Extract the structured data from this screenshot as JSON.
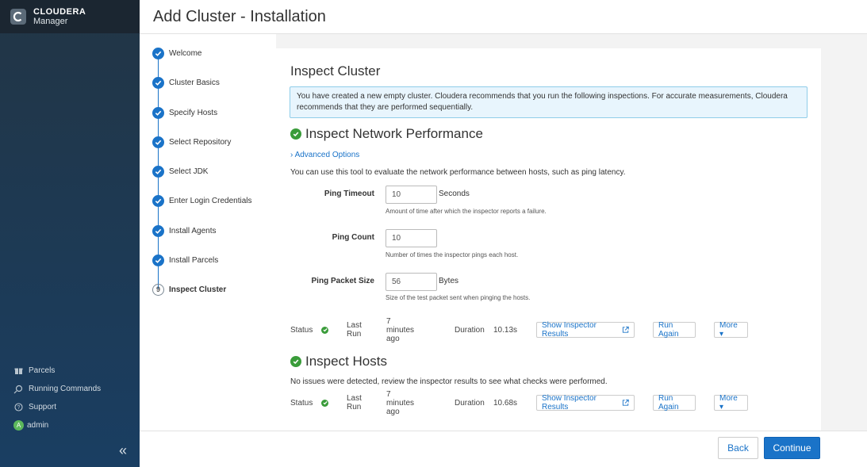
{
  "brand": {
    "line1": "CLOUDERA",
    "line2": "Manager",
    "logo_icon": "cloudera-logo"
  },
  "header": {
    "title": "Add Cluster - Installation"
  },
  "sidebar": {
    "items": [
      {
        "label": "Parcels",
        "icon": "gift-icon"
      },
      {
        "label": "Running Commands",
        "icon": "commands-icon"
      },
      {
        "label": "Support",
        "icon": "help-circle-icon"
      },
      {
        "label": "admin",
        "icon": "avatar",
        "avatar_letter": "A"
      }
    ],
    "collapse_glyph": "«"
  },
  "steps": [
    {
      "label": "Welcome",
      "state": "done"
    },
    {
      "label": "Cluster Basics",
      "state": "done"
    },
    {
      "label": "Specify Hosts",
      "state": "done"
    },
    {
      "label": "Select Repository",
      "state": "done"
    },
    {
      "label": "Select JDK",
      "state": "done"
    },
    {
      "label": "Enter Login Credentials",
      "state": "done"
    },
    {
      "label": "Install Agents",
      "state": "done"
    },
    {
      "label": "Install Parcels",
      "state": "done"
    },
    {
      "label": "Inspect Cluster",
      "state": "active",
      "number": "9"
    }
  ],
  "panel": {
    "title": "Inspect Cluster",
    "info": "You have created a new empty cluster. Cloudera recommends that you run the following inspections. For accurate measurements, Cloudera recommends that they are performed sequentially.",
    "network": {
      "title": "Inspect Network Performance",
      "advanced": "Advanced Options",
      "description": "You can use this tool to evaluate the network performance between hosts, such as ping latency.",
      "fields": [
        {
          "label": "Ping Timeout",
          "value": "10",
          "unit": "Seconds",
          "help": "Amount of time after which the inspector reports a failure."
        },
        {
          "label": "Ping Count",
          "value": "10",
          "unit": "",
          "help": "Number of times the inspector pings each host."
        },
        {
          "label": "Ping Packet Size",
          "value": "56",
          "unit": "Bytes",
          "help": "Size of the test packet sent when pinging the hosts."
        }
      ],
      "status": {
        "status_label": "Status",
        "last_run_label": "Last Run",
        "last_run": "7 minutes ago",
        "duration_label": "Duration",
        "duration": "10.13s"
      }
    },
    "hosts": {
      "title": "Inspect Hosts",
      "description": "No issues were detected, review the inspector results to see what checks were performed.",
      "status": {
        "status_label": "Status",
        "last_run_label": "Last Run",
        "last_run": "7 minutes ago",
        "duration_label": "Duration",
        "duration": "10.68s"
      }
    },
    "buttons": {
      "show_results": "Show Inspector Results",
      "run_again": "Run Again",
      "more": "More ▾"
    }
  },
  "footer": {
    "back": "Back",
    "continue": "Continue"
  },
  "colors": {
    "accent": "#1a73c8",
    "success": "#3a9c3a",
    "sidebar": "#1d3a55"
  }
}
